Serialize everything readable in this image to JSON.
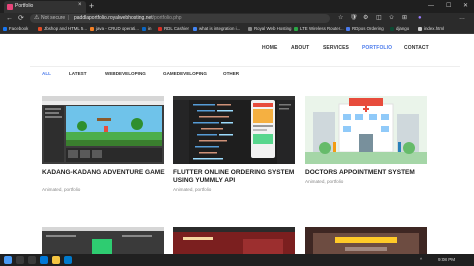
{
  "browser": {
    "tab_title": "Portfolio",
    "tab_close": "×",
    "new_tab": "+",
    "security_label": "Not secure",
    "url_host": "paddlaportfolio.royalwebhosting.net",
    "url_path": "/portfolio.php",
    "icons": {
      "back": "←",
      "refresh": "⟳",
      "minimize": "—",
      "maximize": "☐",
      "close": "✕",
      "lock": "⚠",
      "star": "☆",
      "shield": "🛡",
      "extensions": "⚙",
      "split": "◫",
      "favorites": "✩",
      "collections": "⊞",
      "profile": "●",
      "menu": "…"
    },
    "bookmarks": [
      {
        "label": "Facebook",
        "color": "#1877f2"
      },
      {
        "label": "Jbshop and HTML 5...",
        "color": "#e34c26"
      },
      {
        "label": "java - CRUD operati...",
        "color": "#f48024"
      },
      {
        "label": "in",
        "color": "#0a66c2"
      },
      {
        "label": "RDL Cashier",
        "color": "#d93025"
      },
      {
        "label": "what is integration i...",
        "color": "#4285f4"
      },
      {
        "label": "Royal Web Hosting",
        "color": "#888888"
      },
      {
        "label": "LTE Wireless Router...",
        "color": "#2aa745"
      },
      {
        "label": "RDpos Ordering",
        "color": "#4b7bec"
      },
      {
        "label": "django",
        "color": "#0c4b33"
      },
      {
        "label": "index.html",
        "color": "#cccccc"
      }
    ]
  },
  "site": {
    "nav": [
      {
        "label": "HOME",
        "active": false
      },
      {
        "label": "ABOUT",
        "active": false
      },
      {
        "label": "SERVICES",
        "active": false
      },
      {
        "label": "PORTFOLIO",
        "active": true
      },
      {
        "label": "CONTACT",
        "active": false
      }
    ],
    "filters": [
      {
        "label": "ALL",
        "active": true
      },
      {
        "label": "LATEST",
        "active": false
      },
      {
        "label": "WEBDEVELOPING",
        "active": false
      },
      {
        "label": "GAMEDEVELOPING",
        "active": false
      },
      {
        "label": "OTHER",
        "active": false
      }
    ],
    "projects": [
      {
        "title": "KADANG-KADANG ADVENTURE GAME",
        "category": "Animated, portfolio"
      },
      {
        "title": "FLUTTER ONLINE ORDERING SYSTEM USING YUMMLY API",
        "category": "Animated, portfolio"
      },
      {
        "title": "DOCTORS APPOINTMENT SYSTEM",
        "category": "Animated, portfolio"
      }
    ],
    "accent_color": "#4b7bec"
  },
  "taskbar": {
    "time": "9:08 PM",
    "tray_icon": "^"
  }
}
